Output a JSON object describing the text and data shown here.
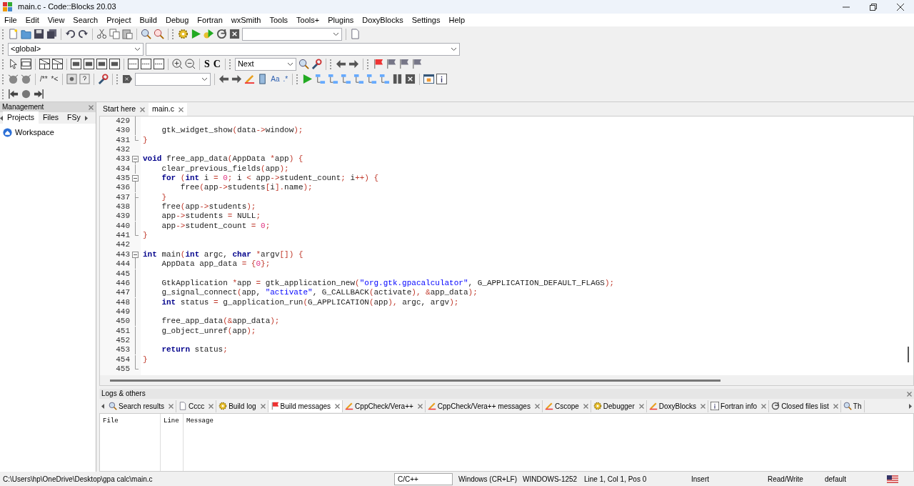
{
  "window": {
    "title": "main.c - Code::Blocks 20.03"
  },
  "menu": [
    "File",
    "Edit",
    "View",
    "Search",
    "Project",
    "Build",
    "Debug",
    "Fortran",
    "wxSmith",
    "Tools",
    "Tools+",
    "Plugins",
    "DoxyBlocks",
    "Settings",
    "Help"
  ],
  "scope_bar": {
    "scope": "<global>"
  },
  "toolbar_search": {
    "direction": "Next",
    "letters": [
      "S",
      "C"
    ]
  },
  "toolbar_doc": {
    "comment_glyphs": [
      "/**",
      "*<"
    ],
    "regex_glyphs": [
      "Aa",
      ".*"
    ]
  },
  "management": {
    "title": "Management",
    "tabs": [
      {
        "label": "Projects",
        "selected": true
      },
      {
        "label": "Files",
        "selected": false
      },
      {
        "label": "FSy",
        "selected": false
      }
    ],
    "tree": [
      {
        "label": "Workspace"
      }
    ]
  },
  "editor": {
    "tabs": [
      {
        "label": "Start here",
        "selected": false
      },
      {
        "label": "main.c",
        "selected": true
      }
    ],
    "lines": [
      {
        "number": "429",
        "kind": "bar"
      },
      {
        "number": "430",
        "kind": "bar",
        "code": [
          {
            "kind": "t",
            "text": "    gtk_widget_show"
          },
          {
            "kind": "o",
            "text": "("
          },
          {
            "kind": "t",
            "text": "data"
          },
          {
            "kind": "o",
            "text": "->"
          },
          {
            "kind": "t",
            "text": "window"
          },
          {
            "kind": "o",
            "text": ");"
          }
        ]
      },
      {
        "number": "431",
        "kind": "close",
        "code": [
          {
            "kind": "o",
            "text": "}"
          }
        ]
      },
      {
        "number": "432"
      },
      {
        "number": "433",
        "kind": "open",
        "code": [
          {
            "kind": "k",
            "text": "void"
          },
          {
            "kind": "t",
            "text": " free_app_data"
          },
          {
            "kind": "o",
            "text": "("
          },
          {
            "kind": "t",
            "text": "AppData "
          },
          {
            "kind": "o",
            "text": "*"
          },
          {
            "kind": "t",
            "text": "app"
          },
          {
            "kind": "o",
            "text": ") {"
          }
        ]
      },
      {
        "number": "434",
        "kind": "bar",
        "code": [
          {
            "kind": "t",
            "text": "    clear_previous_fields"
          },
          {
            "kind": "o",
            "text": "("
          },
          {
            "kind": "t",
            "text": "app"
          },
          {
            "kind": "o",
            "text": ");"
          }
        ]
      },
      {
        "number": "435",
        "kind": "open",
        "code": [
          {
            "kind": "k",
            "text": "    for"
          },
          {
            "kind": "o",
            "text": " ("
          },
          {
            "kind": "k",
            "text": "int"
          },
          {
            "kind": "t",
            "text": " i "
          },
          {
            "kind": "o",
            "text": "="
          },
          {
            "kind": "n",
            "text": " 0"
          },
          {
            "kind": "o",
            "text": ";"
          },
          {
            "kind": "t",
            "text": " i "
          },
          {
            "kind": "o",
            "text": "<"
          },
          {
            "kind": "t",
            "text": " app"
          },
          {
            "kind": "o",
            "text": "->"
          },
          {
            "kind": "t",
            "text": "student_count"
          },
          {
            "kind": "o",
            "text": ";"
          },
          {
            "kind": "t",
            "text": " i"
          },
          {
            "kind": "o",
            "text": "++) {"
          }
        ]
      },
      {
        "number": "436",
        "kind": "bar",
        "code": [
          {
            "kind": "t",
            "text": "        free"
          },
          {
            "kind": "o",
            "text": "("
          },
          {
            "kind": "t",
            "text": "app"
          },
          {
            "kind": "o",
            "text": "->"
          },
          {
            "kind": "t",
            "text": "students"
          },
          {
            "kind": "o",
            "text": "["
          },
          {
            "kind": "t",
            "text": "i"
          },
          {
            "kind": "o",
            "text": "]."
          },
          {
            "kind": "t",
            "text": "name"
          },
          {
            "kind": "o",
            "text": ");"
          }
        ]
      },
      {
        "number": "437",
        "kind": "tick",
        "code": [
          {
            "kind": "o",
            "text": "    }"
          }
        ]
      },
      {
        "number": "438",
        "kind": "bar",
        "code": [
          {
            "kind": "t",
            "text": "    free"
          },
          {
            "kind": "o",
            "text": "("
          },
          {
            "kind": "t",
            "text": "app"
          },
          {
            "kind": "o",
            "text": "->"
          },
          {
            "kind": "t",
            "text": "students"
          },
          {
            "kind": "o",
            "text": ");"
          }
        ]
      },
      {
        "number": "439",
        "kind": "bar",
        "code": [
          {
            "kind": "t",
            "text": "    app"
          },
          {
            "kind": "o",
            "text": "->"
          },
          {
            "kind": "t",
            "text": "students "
          },
          {
            "kind": "o",
            "text": "="
          },
          {
            "kind": "t",
            "text": " NULL"
          },
          {
            "kind": "o",
            "text": ";"
          }
        ]
      },
      {
        "number": "440",
        "kind": "bar",
        "code": [
          {
            "kind": "t",
            "text": "    app"
          },
          {
            "kind": "o",
            "text": "->"
          },
          {
            "kind": "t",
            "text": "student_count "
          },
          {
            "kind": "o",
            "text": "="
          },
          {
            "kind": "n",
            "text": " 0"
          },
          {
            "kind": "o",
            "text": ";"
          }
        ]
      },
      {
        "number": "441",
        "kind": "close",
        "code": [
          {
            "kind": "o",
            "text": "}"
          }
        ]
      },
      {
        "number": "442"
      },
      {
        "number": "443",
        "kind": "open",
        "code": [
          {
            "kind": "k",
            "text": "int"
          },
          {
            "kind": "t",
            "text": " main"
          },
          {
            "kind": "o",
            "text": "("
          },
          {
            "kind": "k",
            "text": "int"
          },
          {
            "kind": "t",
            "text": " argc, "
          },
          {
            "kind": "k",
            "text": "char"
          },
          {
            "kind": "o",
            "text": " *"
          },
          {
            "kind": "t",
            "text": "argv"
          },
          {
            "kind": "o",
            "text": "[]) {"
          }
        ]
      },
      {
        "number": "444",
        "kind": "bar",
        "code": [
          {
            "kind": "t",
            "text": "    AppData app_data "
          },
          {
            "kind": "o",
            "text": "= {"
          },
          {
            "kind": "n",
            "text": "0"
          },
          {
            "kind": "o",
            "text": "};"
          }
        ]
      },
      {
        "number": "445",
        "kind": "bar"
      },
      {
        "number": "446",
        "kind": "bar",
        "code": [
          {
            "kind": "t",
            "text": "    GtkApplication "
          },
          {
            "kind": "o",
            "text": "*"
          },
          {
            "kind": "t",
            "text": "app "
          },
          {
            "kind": "o",
            "text": "="
          },
          {
            "kind": "t",
            "text": " gtk_application_new"
          },
          {
            "kind": "o",
            "text": "("
          },
          {
            "kind": "s",
            "text": "\"org.gtk.gpacalculator\""
          },
          {
            "kind": "t",
            "text": ", G_APPLICATION_DEFAULT_FLAGS"
          },
          {
            "kind": "o",
            "text": ");"
          }
        ]
      },
      {
        "number": "447",
        "kind": "bar",
        "code": [
          {
            "kind": "t",
            "text": "    g_signal_connect"
          },
          {
            "kind": "o",
            "text": "("
          },
          {
            "kind": "t",
            "text": "app, "
          },
          {
            "kind": "s",
            "text": "\"activate\""
          },
          {
            "kind": "t",
            "text": ", G_CALLBACK"
          },
          {
            "kind": "o",
            "text": "("
          },
          {
            "kind": "t",
            "text": "activate"
          },
          {
            "kind": "o",
            "text": "), &"
          },
          {
            "kind": "t",
            "text": "app_data"
          },
          {
            "kind": "o",
            "text": ");"
          }
        ]
      },
      {
        "number": "448",
        "kind": "bar",
        "code": [
          {
            "kind": "k",
            "text": "    int"
          },
          {
            "kind": "t",
            "text": " status "
          },
          {
            "kind": "o",
            "text": "="
          },
          {
            "kind": "t",
            "text": " g_application_run"
          },
          {
            "kind": "o",
            "text": "("
          },
          {
            "kind": "t",
            "text": "G_APPLICATION"
          },
          {
            "kind": "o",
            "text": "("
          },
          {
            "kind": "t",
            "text": "app"
          },
          {
            "kind": "o",
            "text": "),"
          },
          {
            "kind": "t",
            "text": " argc, argv"
          },
          {
            "kind": "o",
            "text": ");"
          }
        ]
      },
      {
        "number": "449",
        "kind": "bar"
      },
      {
        "number": "450",
        "kind": "bar",
        "code": [
          {
            "kind": "t",
            "text": "    free_app_data"
          },
          {
            "kind": "o",
            "text": "(&"
          },
          {
            "kind": "t",
            "text": "app_data"
          },
          {
            "kind": "o",
            "text": ");"
          }
        ]
      },
      {
        "number": "451",
        "kind": "bar",
        "code": [
          {
            "kind": "t",
            "text": "    g_object_unref"
          },
          {
            "kind": "o",
            "text": "("
          },
          {
            "kind": "t",
            "text": "app"
          },
          {
            "kind": "o",
            "text": ");"
          }
        ]
      },
      {
        "number": "452",
        "kind": "bar"
      },
      {
        "number": "453",
        "kind": "bar",
        "code": [
          {
            "kind": "k",
            "text": "    return"
          },
          {
            "kind": "t",
            "text": " status"
          },
          {
            "kind": "o",
            "text": ";"
          }
        ]
      },
      {
        "number": "454",
        "kind": "bar",
        "code": [
          {
            "kind": "o",
            "text": "}"
          }
        ]
      },
      {
        "number": "455",
        "kind": "close"
      }
    ]
  },
  "logs": {
    "title": "Logs & others",
    "tabs": [
      {
        "label": "Search results",
        "selected": false
      },
      {
        "label": "Cccc",
        "selected": false
      },
      {
        "label": "Build log",
        "selected": false
      },
      {
        "label": "Build messages",
        "selected": true
      },
      {
        "label": "CppCheck/Vera++",
        "selected": false
      },
      {
        "label": "CppCheck/Vera++ messages",
        "selected": false
      },
      {
        "label": "Cscope",
        "selected": false
      },
      {
        "label": "Debugger",
        "selected": false
      },
      {
        "label": "DoxyBlocks",
        "selected": false
      },
      {
        "label": "Fortran info",
        "selected": false
      },
      {
        "label": "Closed files list",
        "selected": false
      },
      {
        "label": "Th",
        "selected": false
      }
    ],
    "columns": [
      "File",
      "Line",
      "Message"
    ]
  },
  "status_bar": {
    "path": "C:\\Users\\hp\\OneDrive\\Desktop\\gpa calc\\main.c",
    "language": "C/C++",
    "line_endings": "Windows (CR+LF)",
    "encoding": "WINDOWS-1252",
    "position": "Line 1, Col 1, Pos 0",
    "mode": "Insert",
    "access": "Read/Write",
    "theme": "default"
  }
}
